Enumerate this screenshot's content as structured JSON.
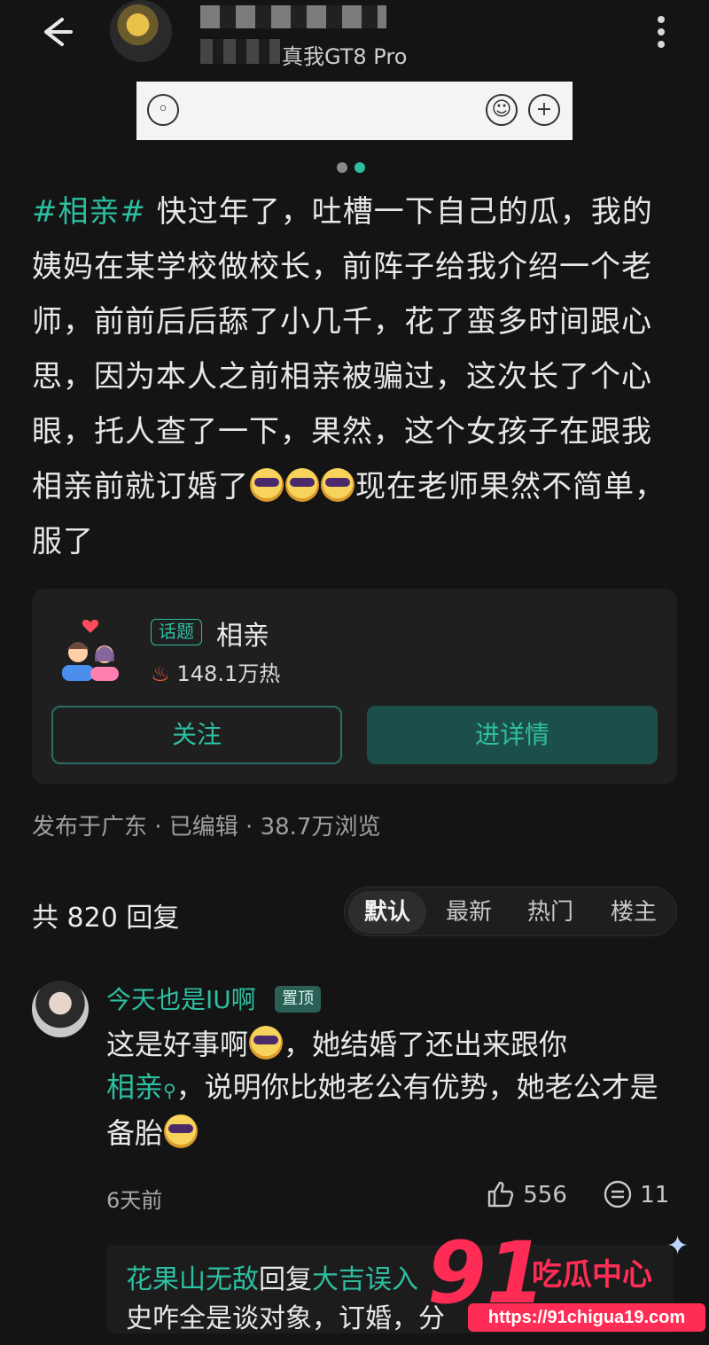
{
  "header": {
    "device": "真我GT8 Pro"
  },
  "post": {
    "hashtag": "#相亲#",
    "text_part1": " 快过年了，吐槽一下自己的瓜，我的姨妈在某学校做校长，前阵子给我介绍一个老师，前前后后舔了小几千，花了蛮多时间跟心思，因为本人之前相亲被骗过，这次长了个心眼，托人查了一下，果然，这个女孩子在跟我相亲前就订婚了",
    "text_part2": "现在老师果然不简单，服了"
  },
  "topic": {
    "badge": "话题",
    "name": "相亲",
    "hot": "148.1万热",
    "follow_label": "关注",
    "detail_label": "进详情"
  },
  "meta": "发布于广东 · 已编辑 · 38.7万浏览",
  "replies": {
    "count_label": "共 820 回复",
    "tabs": [
      "默认",
      "最新",
      "热门",
      "楼主"
    ]
  },
  "comment": {
    "user": "今天也是IU啊",
    "pin": "置顶",
    "text_a": "这是好事啊",
    "text_b": "，她结婚了还出来跟你",
    "link": "相亲",
    "text_c": "，说明你比她老公有优势，她老公才是备胎",
    "time": "6天前",
    "likes": "556",
    "reply_count": "11"
  },
  "sub_reply": {
    "user": "花果山无敌",
    "verb": "回复",
    "target": "大吉误入",
    "line2": "史咋全是谈对象，订婚，分"
  },
  "watermark": {
    "number": "91",
    "title": "吃瓜中心",
    "url": "https://91chigua19.com"
  }
}
